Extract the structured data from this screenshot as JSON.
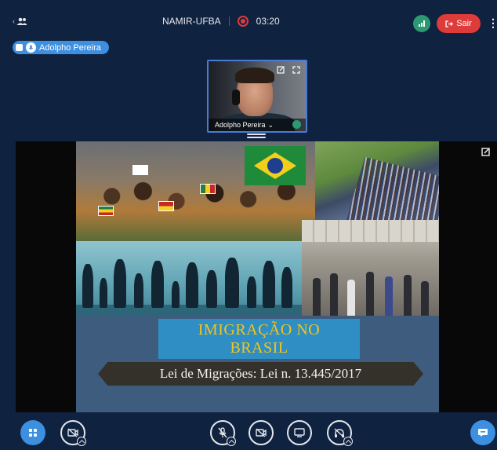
{
  "topbar": {
    "meeting_name": "NAMIR-UFBA",
    "recording_time": "03:20",
    "leave_label": "Sair"
  },
  "talking_indicator": {
    "name": "Adolpho Pereira"
  },
  "webcam": {
    "user_name": "Adolpho Pereira"
  },
  "slide": {
    "title_line1": "IMIGRAÇÃO NO",
    "title_line2": "BRASIL",
    "subtitle": "Lei de Migrações: Lei n. 13.445/2017"
  },
  "colors": {
    "background": "#0f2240",
    "accent_blue": "#3d8fe0",
    "leave_red": "#de3b3b",
    "connection_green": "#2b9a73",
    "slide_title_yellow": "#f5c518"
  },
  "icons": {
    "users": "users-icon",
    "record": "record-icon",
    "connection": "signal-icon",
    "leave": "logout-icon",
    "more": "more-vertical-icon",
    "actions": "grid-icon",
    "camera_off": "camera-off-icon",
    "mic_off": "mic-off-icon",
    "screen_share": "screen-share-icon",
    "presentation": "presentation-icon",
    "audio_off": "headphone-off-icon",
    "chat": "chat-icon"
  }
}
